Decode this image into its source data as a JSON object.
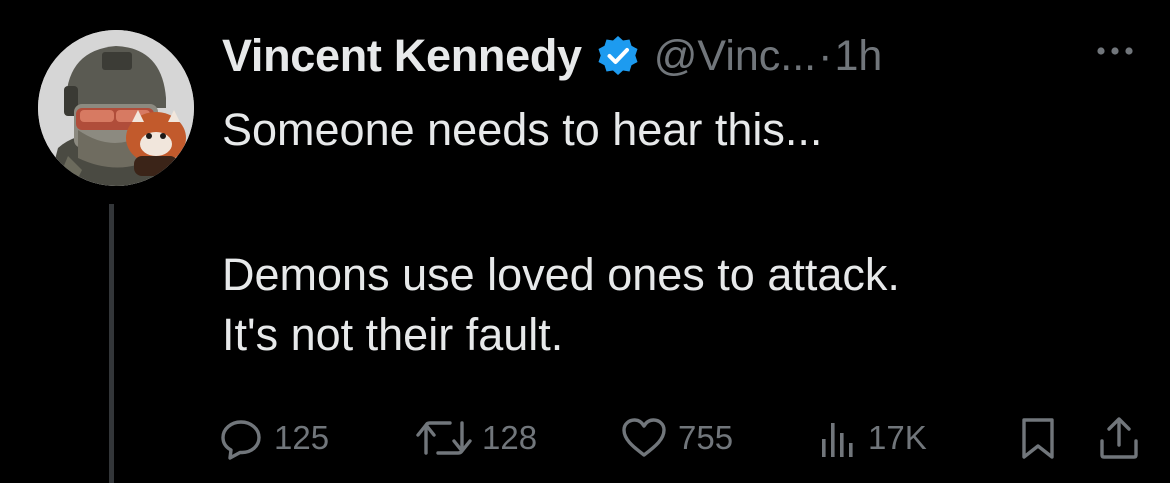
{
  "tweet": {
    "author": {
      "display_name": "Vincent Kennedy",
      "handle": "@Vinc...",
      "verified": true,
      "avatar_icon": "avatar-soldier-red-panda"
    },
    "separator": "·",
    "time": "1h",
    "more_icon": "more-dots-icon",
    "text": {
      "line1": "Someone needs to hear this...",
      "line2": "Demons use loved ones to attack.",
      "line3": "It's not their fault."
    },
    "actions": {
      "replies": "125",
      "retweets": "128",
      "likes": "755",
      "views": "17K"
    }
  },
  "colors": {
    "background": "#000000",
    "text_primary": "#e7e9ea",
    "text_secondary": "#71767b",
    "verified_blue": "#1d9bf0",
    "thread_line": "#333639"
  }
}
